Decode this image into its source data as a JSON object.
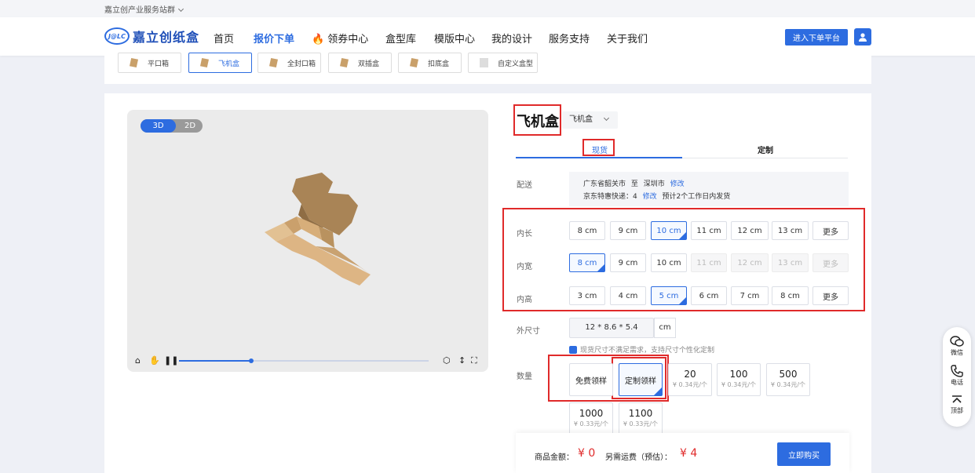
{
  "top_bar": {
    "group": "嘉立创产业服务站群"
  },
  "nav": {
    "logo_badge": "J@LC",
    "logo_text": "嘉立创纸盒",
    "items": [
      "首页",
      "报价下单",
      "领券中心",
      "盒型库",
      "模版中心",
      "我的设计",
      "服务支持",
      "关于我们"
    ],
    "enter_btn": "进入下单平台"
  },
  "categories": [
    "平口箱",
    "飞机盒",
    "全封口箱",
    "双插盒",
    "扣底盒",
    "自定义盒型"
  ],
  "viewer": {
    "toggle_3d": "3D",
    "toggle_2d": "2D",
    "progress": 0.29
  },
  "product": {
    "title": "飞机盒",
    "type_select": "飞机盒",
    "tab_stock": "现货",
    "tab_custom": "定制"
  },
  "delivery": {
    "label": "配送",
    "from": "广东省韶关市",
    "to_word": "至",
    "to": "深圳市",
    "edit": "修改",
    "express": "京东特惠快递：4",
    "express_edit": "修改",
    "ship_note": "预计2个工作日内发货"
  },
  "sizes": {
    "length": {
      "label": "内长",
      "options": [
        "8 cm",
        "9 cm",
        "10 cm",
        "11 cm",
        "12 cm",
        "13 cm",
        "更多"
      ],
      "selected": 2,
      "disabled": []
    },
    "width": {
      "label": "内宽",
      "options": [
        "8 cm",
        "9 cm",
        "10 cm",
        "11 cm",
        "12 cm",
        "13 cm",
        "更多"
      ],
      "selected": 0,
      "disabled": [
        3,
        4,
        5,
        6
      ]
    },
    "height": {
      "label": "内高",
      "options": [
        "3 cm",
        "4 cm",
        "5 cm",
        "6 cm",
        "7 cm",
        "8 cm",
        "更多"
      ],
      "selected": 2,
      "disabled": []
    }
  },
  "outer": {
    "label": "外尺寸",
    "value": "12 * 8.6 * 5.4",
    "unit": "cm",
    "hint": "现货尺寸不满足需求，支持尺寸个性化定制"
  },
  "quantity": {
    "label": "数量",
    "free_sample": "免费领样",
    "custom_sample": "定制领样",
    "options": [
      {
        "n": "20",
        "p": "¥ 0.34元/个"
      },
      {
        "n": "100",
        "p": "¥ 0.34元/个"
      },
      {
        "n": "500",
        "p": "¥ 0.34元/个"
      },
      {
        "n": "1000",
        "p": "¥ 0.33元/个"
      },
      {
        "n": "1100",
        "p": "¥ 0.33元/个"
      }
    ]
  },
  "summary": {
    "goods_label": "商品金额：",
    "goods_value": "¥ 0",
    "ship_label": "另需运费（预估）：",
    "ship_value": "¥ 4",
    "buy_btn": "立即购买"
  },
  "sidebar": {
    "wechat": "微信",
    "phone": "电话",
    "top": "顶部"
  },
  "colors": {
    "accent": "#2d6ce0",
    "highlight": "#e02a2a",
    "price": "#e02a2a"
  }
}
